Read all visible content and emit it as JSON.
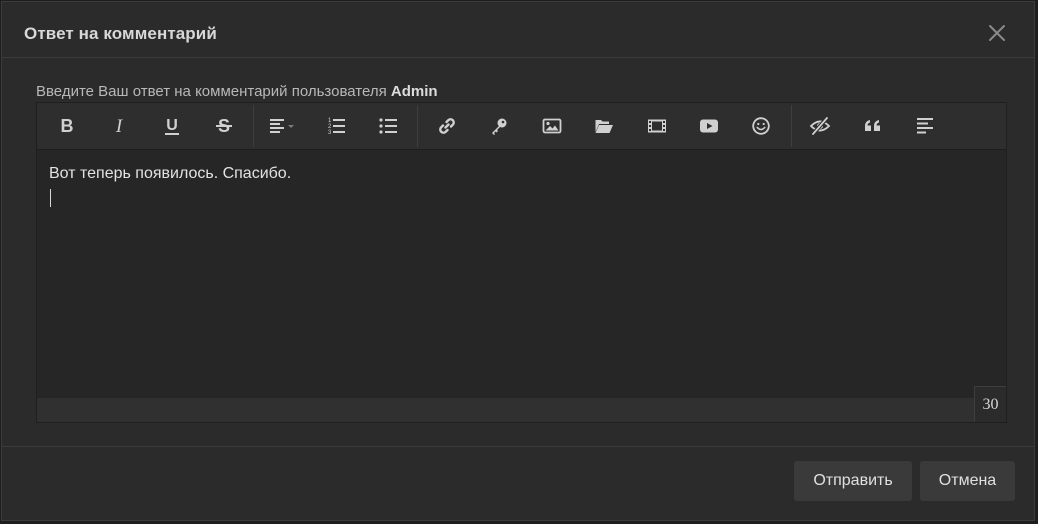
{
  "dialog": {
    "title": "Ответ на комментарий",
    "close_icon": "close-icon"
  },
  "prompt": {
    "text": "Введите Ваш ответ на комментарий пользователя ",
    "username": "Admin"
  },
  "toolbar": {
    "buttons": [
      {
        "name": "bold-button",
        "icon": "bold-icon"
      },
      {
        "name": "italic-button",
        "icon": "italic-icon"
      },
      {
        "name": "underline-button",
        "icon": "underline-icon"
      },
      {
        "name": "strikethrough-button",
        "icon": "strikethrough-icon"
      },
      {
        "name": "align-dropdown-button",
        "icon": "align-left-icon"
      },
      {
        "name": "ordered-list-button",
        "icon": "ordered-list-icon"
      },
      {
        "name": "unordered-list-button",
        "icon": "unordered-list-icon"
      },
      {
        "name": "link-button",
        "icon": "link-icon"
      },
      {
        "name": "key-button",
        "icon": "key-icon"
      },
      {
        "name": "image-button",
        "icon": "image-icon"
      },
      {
        "name": "folder-button",
        "icon": "folder-open-icon"
      },
      {
        "name": "video-button",
        "icon": "film-icon"
      },
      {
        "name": "youtube-button",
        "icon": "youtube-icon"
      },
      {
        "name": "emoji-button",
        "icon": "smiley-icon"
      },
      {
        "name": "hide-button",
        "icon": "eye-slash-icon"
      },
      {
        "name": "quote-button",
        "icon": "quote-icon"
      },
      {
        "name": "format-button",
        "icon": "align-text-icon"
      }
    ]
  },
  "editor": {
    "content": "Вот теперь появилось. Спасибо.",
    "char_count": "30"
  },
  "footer": {
    "submit_label": "Отправить",
    "cancel_label": "Отмена"
  },
  "colors": {
    "background": "#2b2b2b",
    "editor_bg": "#262626",
    "toolbar_bg": "#2e2e2e",
    "button_bg": "#3a3a3a",
    "text": "#e2e2e2",
    "icon": "#d0d0d0"
  }
}
